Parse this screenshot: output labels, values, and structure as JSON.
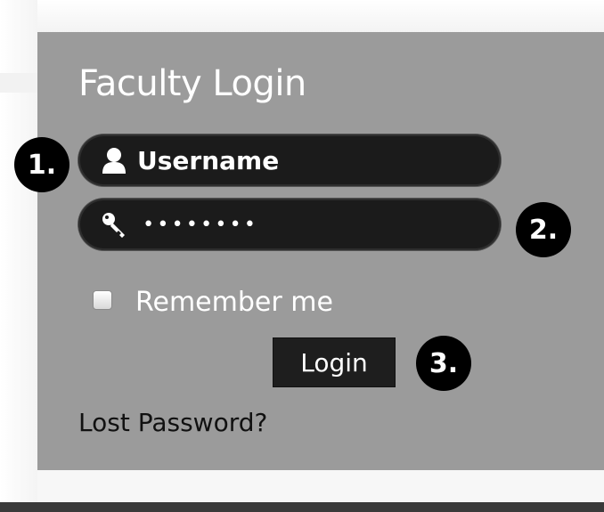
{
  "login_box": {
    "title": "Faculty Login",
    "username": {
      "placeholder": "Username",
      "icon": "user-icon"
    },
    "password": {
      "masked_value": "••••••••",
      "icon": "key-icon"
    },
    "remember_label": "Remember me",
    "remember_checked": false,
    "login_button": "Login",
    "lost_password_link": "Lost Password?"
  },
  "annotations": [
    {
      "label": "1."
    },
    {
      "label": "2."
    },
    {
      "label": "3."
    }
  ],
  "colors": {
    "panel": "#9b9b9b",
    "field": "#1b1b1b",
    "button": "#1e1e1e",
    "badge": "#000000"
  }
}
